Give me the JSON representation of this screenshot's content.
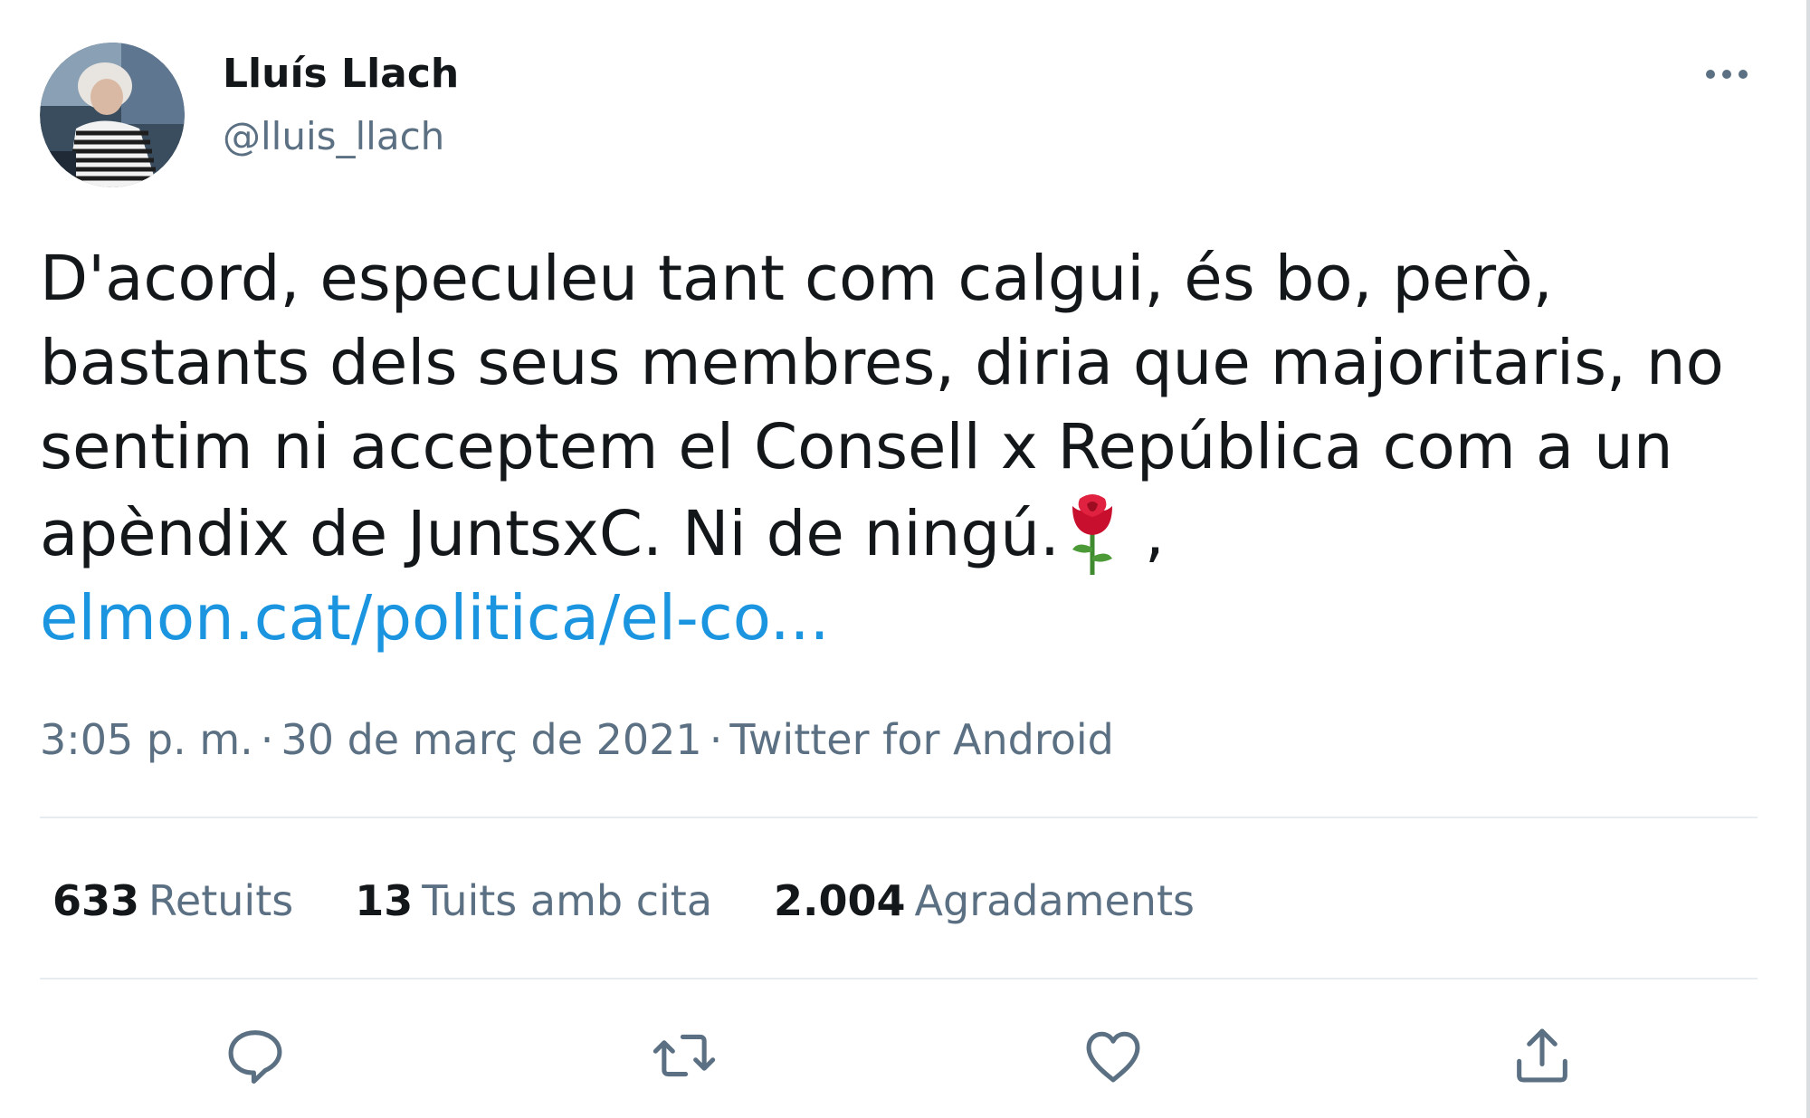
{
  "user": {
    "display_name": "Lluís Llach",
    "handle": "@lluis_llach"
  },
  "tweet": {
    "lines": [
      "D'acord, especuleu tant com calgui, és bo, però,",
      "bastants dels seus membres, diria que majoritaris, no",
      "sentim ni acceptem el Consell x República com a un"
    ],
    "line4_text": "apèndix de JuntsxC. Ni de ningú.",
    "line4_emoji": "rose-icon",
    "line4_after": " ,",
    "link": "elmon.cat/politica/el-co..."
  },
  "meta": {
    "time": "3:05 p. m.",
    "separator": "·",
    "date": "30 de març de 2021",
    "source": "Twitter for Android"
  },
  "stats": [
    {
      "count": "633",
      "label": "Retuits"
    },
    {
      "count": "13",
      "label": "Tuits amb cita"
    },
    {
      "count": "2.004",
      "label": "Agradaments"
    }
  ],
  "actions": [
    "reply-icon",
    "retweet-icon",
    "like-icon",
    "share-icon"
  ],
  "colors": {
    "text": "#14171a",
    "secondary": "#5b7083",
    "link": "#1b95e0",
    "divider": "#e6ecf0"
  }
}
